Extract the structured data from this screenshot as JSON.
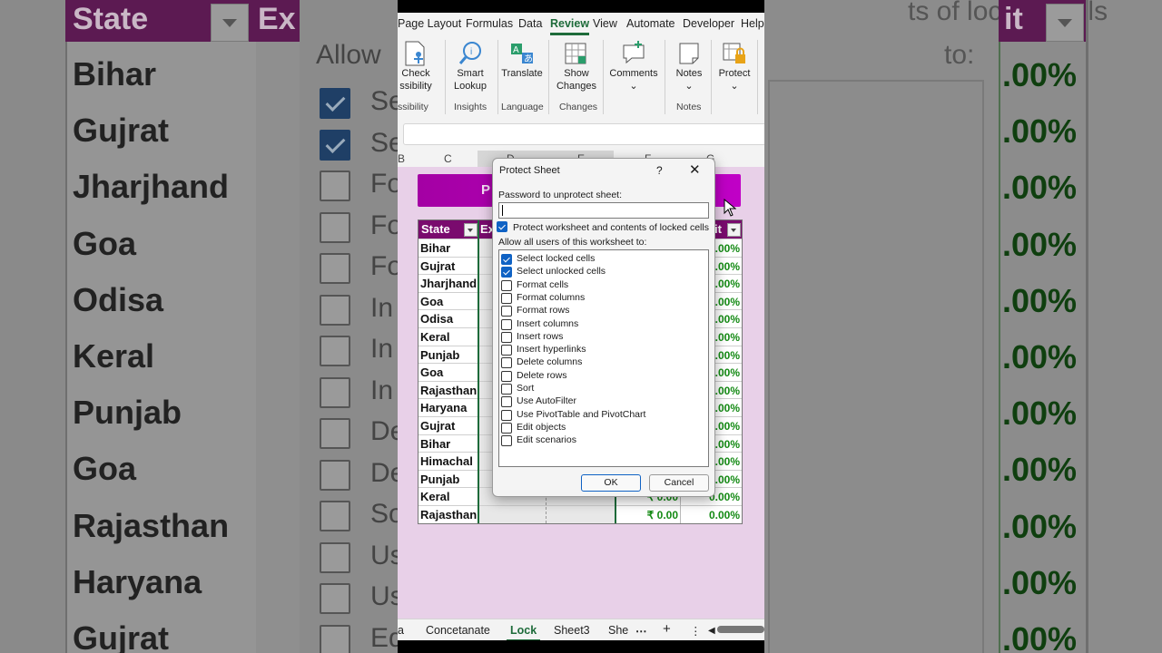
{
  "backdrop": {
    "left_header_state": "State",
    "left_header_ex": "Ex",
    "left_states": [
      "Bihar",
      "Gujrat",
      "Jharjhand",
      "Goa",
      "Odisa",
      "Keral",
      "Punjab",
      "Goa",
      "Rajasthan",
      "Haryana",
      "Gujrat"
    ],
    "mid_allow": "Allow",
    "mid_labels": [
      "Se",
      "Se",
      "Fo",
      "Fo",
      "Fo",
      "In",
      "In",
      "In",
      "De",
      "De",
      "So",
      "Us",
      "Us",
      "Ed"
    ],
    "right_top": "ts of locked cells",
    "right_to": "to:",
    "right_header": "it",
    "right_pcts": [
      ".00%",
      ".00%",
      ".00%",
      ".00%",
      ".00%",
      ".00%",
      ".00%",
      ".00%",
      ".00%",
      ".00%",
      ".00%"
    ]
  },
  "ribbon": {
    "tabs": [
      "Page Layout",
      "Formulas",
      "Data",
      "Review",
      "View",
      "Automate",
      "Developer",
      "Help"
    ],
    "active_tab": "Review",
    "buttons": {
      "check": [
        "Check",
        "ssibility"
      ],
      "smart": [
        "Smart",
        "Lookup"
      ],
      "translate": "Translate",
      "show": [
        "Show",
        "Changes"
      ],
      "comments": "Comments",
      "notes": "Notes",
      "protect": "Protect"
    },
    "groups": {
      "accessibility": "ssibility",
      "insights": "Insights",
      "language": "Language",
      "changes": "Changes",
      "notes": "Notes"
    }
  },
  "columns": [
    "B",
    "C",
    "D",
    "E",
    "F",
    "G"
  ],
  "sheet": {
    "banner_text": "P",
    "header": {
      "state": "State",
      "ex": "Ex",
      "it": "it"
    },
    "rows": [
      {
        "state": "Bihar",
        "pct": ".00%"
      },
      {
        "state": "Gujrat",
        "pct": ".00%"
      },
      {
        "state": "Jharjhand",
        "pct": ".00%"
      },
      {
        "state": "Goa",
        "pct": ".00%"
      },
      {
        "state": "Odisa",
        "pct": ".00%"
      },
      {
        "state": "Keral",
        "pct": ".00%"
      },
      {
        "state": "Punjab",
        "pct": ".00%"
      },
      {
        "state": "Goa",
        "pct": ".00%"
      },
      {
        "state": "Rajasthan",
        "pct": ".00%"
      },
      {
        "state": "Haryana",
        "pct": ".00%"
      },
      {
        "state": "Gujrat",
        "pct": ".00%"
      },
      {
        "state": "Bihar",
        "pct": ".00%"
      },
      {
        "state": "Himachal",
        "pct": ".00%"
      },
      {
        "state": "Punjab",
        "pct": ".00%"
      },
      {
        "state": "Keral",
        "amt": "₹ 0.00",
        "pct": "0.00%"
      },
      {
        "state": "Rajasthan",
        "amt": "₹ 0.00",
        "pct": "0.00%"
      }
    ]
  },
  "sheet_tabs": [
    "a",
    "Concetanate",
    "Lock",
    "Sheet3",
    "She"
  ],
  "active_sheet": "Lock",
  "dialog": {
    "title": "Protect Sheet",
    "help": "?",
    "close": "✕",
    "password_label": "Password to unprotect sheet:",
    "password_value": "",
    "protect_label": "Protect worksheet and contents of locked cells",
    "protect_checked": true,
    "allow_label": "Allow all users of this worksheet to:",
    "items": [
      {
        "label": "Select locked cells",
        "checked": true
      },
      {
        "label": "Select unlocked cells",
        "checked": true
      },
      {
        "label": "Format cells",
        "checked": false
      },
      {
        "label": "Format columns",
        "checked": false
      },
      {
        "label": "Format rows",
        "checked": false
      },
      {
        "label": "Insert columns",
        "checked": false
      },
      {
        "label": "Insert rows",
        "checked": false
      },
      {
        "label": "Insert hyperlinks",
        "checked": false
      },
      {
        "label": "Delete columns",
        "checked": false
      },
      {
        "label": "Delete rows",
        "checked": false
      },
      {
        "label": "Sort",
        "checked": false
      },
      {
        "label": "Use AutoFilter",
        "checked": false
      },
      {
        "label": "Use PivotTable and PivotChart",
        "checked": false
      },
      {
        "label": "Edit objects",
        "checked": false
      },
      {
        "label": "Edit scenarios",
        "checked": false
      }
    ],
    "ok": "OK",
    "cancel": "Cancel"
  },
  "colors": {
    "accent": "#1e6b3a",
    "header": "#7a0b6e",
    "banner": "#b000b8",
    "check": "#0f62c4"
  }
}
